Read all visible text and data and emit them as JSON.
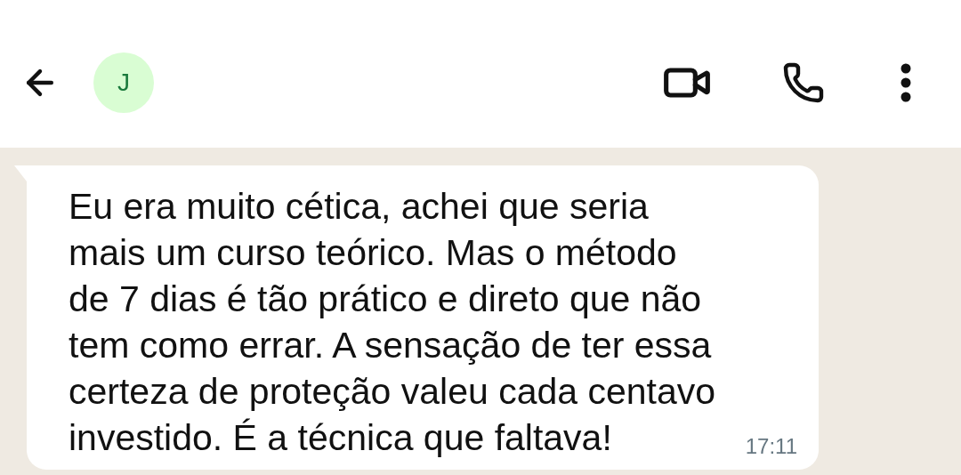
{
  "header": {
    "avatar_letter": "J"
  },
  "message": {
    "lines": [
      "Eu era muito cética, achei que seria",
      "mais um curso teórico. Mas o método",
      "de 7 dias é tão prático e direto que não",
      "tem como errar. A sensação de ter essa",
      "certeza de proteção valeu cada centavo",
      "investido. É a técnica que faltava!"
    ],
    "time": "17:11"
  }
}
